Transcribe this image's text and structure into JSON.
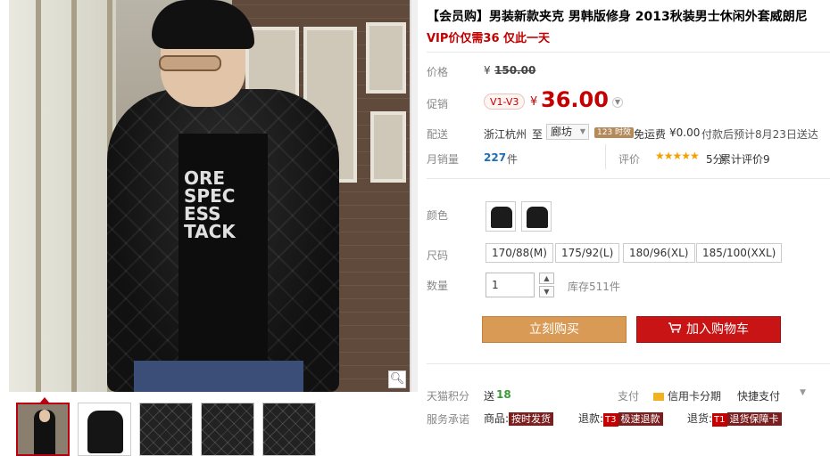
{
  "product": {
    "title": "【会员购】男装新款夹克 男韩版修身 2013秋装男士休闲外套威朗尼",
    "subtitle": "VIP价仅需36 仅此一天"
  },
  "price": {
    "label": "价格",
    "currency": "¥",
    "original": "150.00"
  },
  "promo": {
    "label": "促销",
    "vip_tag": "V1-V3",
    "currency": "¥",
    "price": "36.00"
  },
  "shipping": {
    "label": "配送",
    "from": "浙江杭州",
    "to_word": "至",
    "to": "廊坊",
    "badge": "123 时效",
    "free": "免运费",
    "fee": "¥0.00",
    "note": "付款后预计8月23日送达"
  },
  "sales": {
    "label": "月销量",
    "count": "227",
    "unit": "件",
    "review_label": "评价",
    "stars": "★★★★★",
    "score": "5分",
    "review_text": "累计评价9"
  },
  "color": {
    "label": "颜色"
  },
  "size": {
    "label": "尺码",
    "options": [
      "170/88(M)",
      "175/92(L)",
      "180/96(XL)",
      "185/100(XXL)"
    ]
  },
  "quantity": {
    "label": "数量",
    "value": "1",
    "stock": "库存511件"
  },
  "buttons": {
    "buy_now": "立刻购买",
    "add_cart": "加入购物车"
  },
  "points": {
    "label": "天猫积分",
    "send": "送",
    "amount": "18",
    "pay_label": "支付",
    "credit": "信用卡分期",
    "quick": "快捷支付"
  },
  "services": {
    "label": "服务承诺",
    "goods_label": "商品:",
    "goods_tag": "按时发货",
    "refund_label": "退款:",
    "refund_prefix": "T3",
    "refund_tag": "极速退款",
    "return_label": "退货:",
    "return_prefix": "T1",
    "return_tag": "退货保障卡"
  },
  "image": {
    "tee_text": "ORE SPEC ESS TACK"
  },
  "colors": {
    "accent_red": "#c40000",
    "buy_button": "#d89a54",
    "cart_button": "#c81414"
  }
}
